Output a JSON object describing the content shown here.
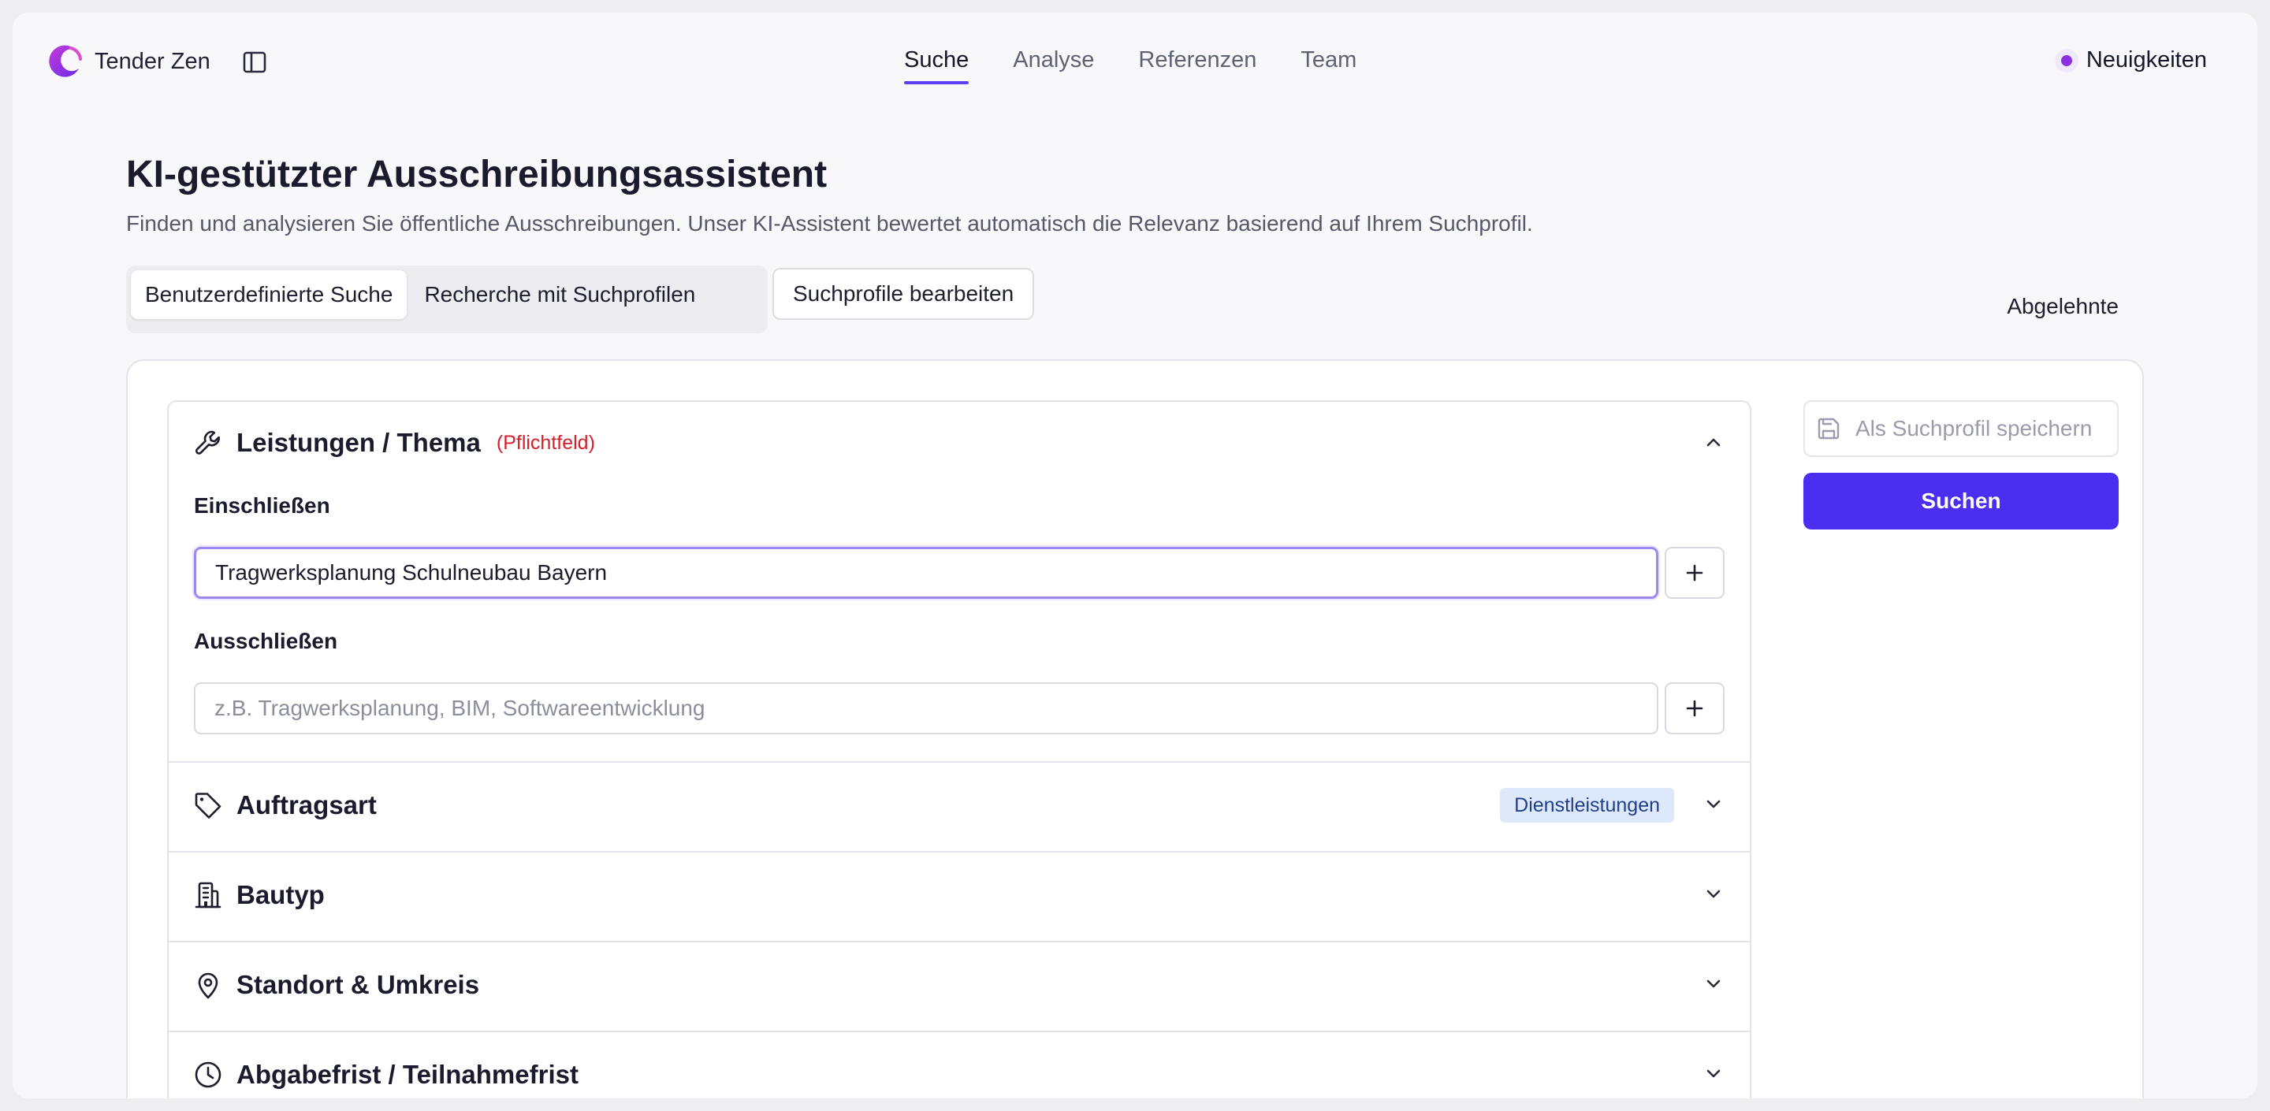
{
  "app": {
    "name": "Tender Zen"
  },
  "nav": {
    "items": [
      "Suche",
      "Analyse",
      "Referenzen",
      "Team"
    ],
    "active": "Suche"
  },
  "news": {
    "label": "Neuigkeiten"
  },
  "header": {
    "title": "KI-gestützter Ausschreibungsassistent",
    "subtitle": "Finden und analysieren Sie öffentliche Ausschreibungen. Unser KI-Assistent bewertet automatisch die Relevanz basierend auf Ihrem Suchprofil."
  },
  "tabs": {
    "custom": "Benutzerdefinierte Suche",
    "profiles": "Recherche mit Suchprofilen"
  },
  "edit_profiles": "Suchprofile bearbeiten",
  "rejected": "Abgelehnte",
  "filters": {
    "services": {
      "title": "Leistungen / Thema",
      "required": "(Pflichtfeld)",
      "include_label": "Einschließen",
      "include_value": "Tragwerksplanung Schulneubau Bayern",
      "exclude_label": "Ausschließen",
      "exclude_placeholder": "z.B. Tragwerksplanung, BIM, Softwareentwicklung"
    },
    "contract_type": {
      "title": "Auftragsart",
      "badge": "Dienstleistungen"
    },
    "building_type": {
      "title": "Bautyp"
    },
    "location": {
      "title": "Standort & Umkreis"
    },
    "deadline": {
      "title": "Abgabefrist / Teilnahmefrist"
    }
  },
  "actions": {
    "save_profile": "Als Suchprofil speichern",
    "search": "Suchen"
  },
  "colors": {
    "accent": "#4a2ff0",
    "nav_underline": "#5b3ff0",
    "required": "#d4202a",
    "badge_bg": "#dde9fb"
  },
  "icons": [
    "logo-icon",
    "sidebar-toggle-icon",
    "wrench-icon",
    "tag-icon",
    "building-icon",
    "map-pin-icon",
    "clock-icon",
    "save-icon",
    "plus-icon",
    "chevron-up-icon",
    "chevron-down-icon"
  ]
}
